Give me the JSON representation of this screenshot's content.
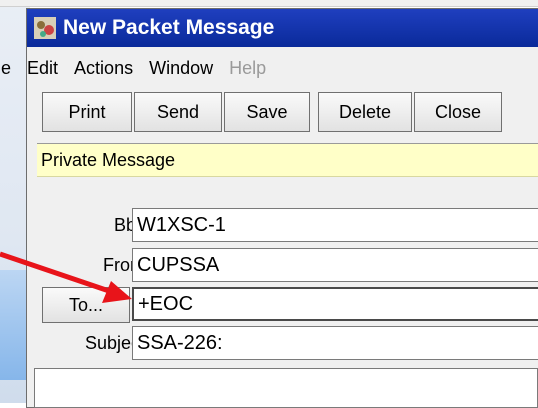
{
  "window": {
    "title": "New Packet Message"
  },
  "menu": [
    {
      "label": "File",
      "disabled": false
    },
    {
      "label": "Edit",
      "disabled": false
    },
    {
      "label": "Actions",
      "disabled": false
    },
    {
      "label": "Window",
      "disabled": false
    },
    {
      "label": "Help",
      "disabled": true
    }
  ],
  "toolbar": {
    "print": "Print",
    "send": "Send",
    "save": "Save",
    "delete": "Delete",
    "close": "Close"
  },
  "banner": {
    "text": "Private Message"
  },
  "form": {
    "bbs_label": "Bbs:",
    "bbs_value": "W1XSC-1",
    "from_label": "From:",
    "from_value": "CUPSSA",
    "to_button": "To...",
    "to_value": "+EOC",
    "subject_label": "Subject:",
    "subject_value": "SSA-226:"
  },
  "colors": {
    "titlebar": "#0a2a9a",
    "banner": "#ffffc8",
    "arrow": "#e8141a"
  },
  "icons": [
    "app-icon",
    "annotation-arrow"
  ]
}
